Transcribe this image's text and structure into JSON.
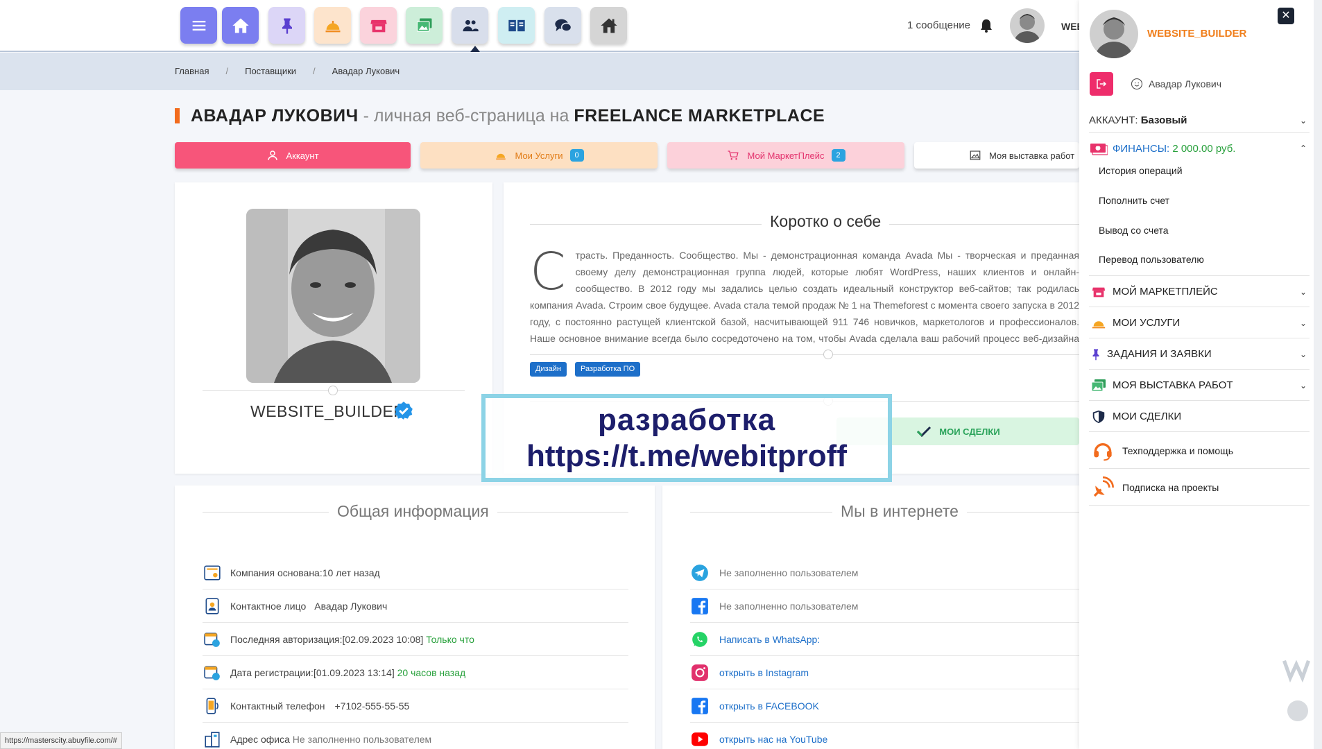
{
  "topbar": {
    "messages_label": "1 сообщение",
    "user_short": "WEBSITE_BUILDER"
  },
  "nav_buttons": [
    {
      "icon": "menu-icon",
      "color": "#7b7ef0"
    },
    {
      "icon": "home-icon",
      "color": "#7b7ef0"
    },
    {
      "icon": "pin-icon",
      "color": "#d9d3f5"
    },
    {
      "icon": "service-bell-icon",
      "color": "#fde4cc"
    },
    {
      "icon": "store-icon",
      "color": "#fbd3dc"
    },
    {
      "icon": "gallery-icon",
      "color": "#cdeed9"
    },
    {
      "icon": "users-icon",
      "color": "#d8deeb"
    },
    {
      "icon": "book-icon",
      "color": "#cfeef2"
    },
    {
      "icon": "chat-icon",
      "color": "#d9e0ec"
    },
    {
      "icon": "house-icon",
      "color": "#d5d5d5"
    }
  ],
  "breadcrumb": {
    "home": "Главная",
    "sep": "/",
    "suppliers": "Поставщики",
    "current": "Авадар Лукович"
  },
  "title": {
    "name": "АВАДАР ЛУКОВИЧ",
    "middle": " - личная веб-страница на ",
    "site": "FREELANCE MARKETPLACE"
  },
  "tabs": {
    "account": "Аккаунт",
    "services": "Мои Услуги",
    "services_count": "0",
    "marketplace": "Мой МаркетПлейс",
    "marketplace_count": "2",
    "exhibition": "Моя выставка работ"
  },
  "profile": {
    "username": "WEBSITE_BUILDER"
  },
  "about": {
    "title": "Коротко о себе",
    "dropcap": "С",
    "text": "трасть. Преданность. Сообщество. Мы - демонстрационная команда Avada Мы - творческая и преданная своему делу демонстрационная группа людей, которые любят WordPress, наших клиентов и онлайн-сообщество. В 2012 году мы задались целью создать идеальный конструктор веб-сайтов; так родилась компания Avada. Строим свое будущее. Avada стала темой продаж № 1 на Themeforest с момента своего запуска в 2012 году, с постоянно растущей клиентской базой, насчитывающей 911 746 новичков, маркетологов и профессионалов. Наше основное внимание всегда было сосредоточено на том, чтобы Avada сделала ваш рабочий процесс веб-дизайна более доступным и приятным.",
    "tags": [
      "Дизайн",
      "Разработка ПО"
    ],
    "deals_button": "МОИ СДЕЛКИ"
  },
  "watermark": {
    "line1": "разработка",
    "line2": "https://t.me/webitproff"
  },
  "general": {
    "title": "Общая информация",
    "founded_label": "Компания основана: ",
    "founded_value": "10 лет назад",
    "contact_label": "Контактное лицо",
    "contact_value": "Авадар Лукович",
    "last_login_label": "Последняя авторизация: ",
    "last_login_value": "[02.09.2023 10:08]",
    "last_login_rel": "Только что",
    "reg_label": "Дата регистрации: ",
    "reg_value": "[01.09.2023 13:14]",
    "reg_rel": "20 часов назад",
    "phone_label": "Контактный телефон",
    "phone_value": "+7102-555-55-55",
    "office_label": "Адрес офиса",
    "office_value": "Не заполненно пользователем"
  },
  "internet": {
    "title": "Мы в интернете",
    "telegram": "Не заполненно пользователем",
    "facebook": "Не заполненно пользователем",
    "whatsapp": "Написать в WhatsApp:",
    "instagram": "открыть в Instagram",
    "facebook_link": "открыть в FACEBOOK",
    "youtube": "открыть нас на YouTube"
  },
  "status_bar": {
    "url": "https://masterscity.abuyfile.com/#"
  },
  "rpanel": {
    "username": "WEBSITE_BUILDER",
    "close": "✕",
    "user_fullname": "Авадар Лукович",
    "account_label": "АККАУНТ: ",
    "account_value": "Базовый",
    "finance_label": "ФИНАНСЫ: ",
    "finance_value": "2 000.00 руб.",
    "finance_sub": [
      "История операций",
      "Пополнить счет",
      "Вывод со счета",
      "Перевод пользователю"
    ],
    "marketplace": "МОЙ МАРКЕТПЛЕЙС",
    "services": "МОИ УСЛУГИ",
    "tasks": "ЗАДАНИЯ И ЗАЯВКИ",
    "exhibition": "МОЯ ВЫСТАВКА РАБОТ",
    "deals": "МОИ СДЕЛКИ",
    "support": "Техподдержка и помощь",
    "subscribe": "Подписка на проекты"
  }
}
